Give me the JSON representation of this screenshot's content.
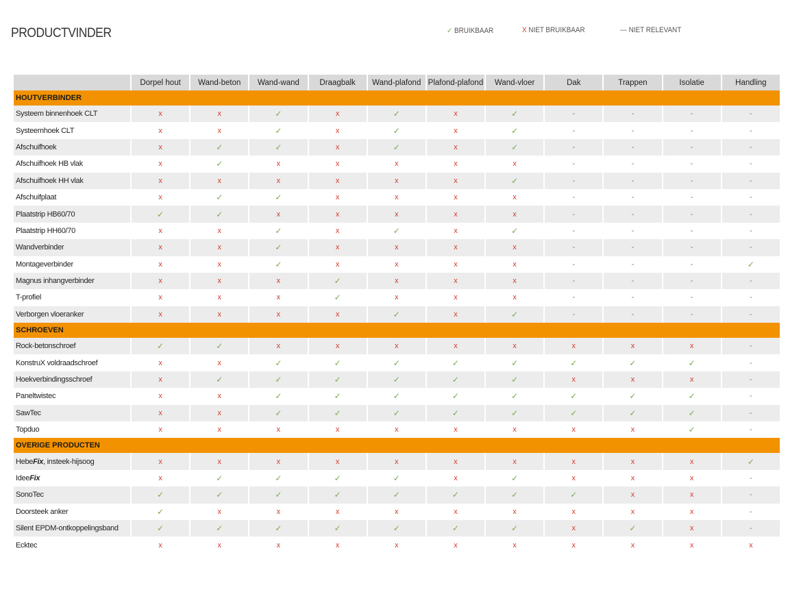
{
  "title": "PRODUCTVINDER",
  "legend": {
    "ok_symbol": "✓",
    "ok_label": "BRUIKBAAR",
    "no_symbol": "X",
    "no_label": "NIET BRUIKBAAR",
    "na_symbol": "—",
    "na_label": "NIET RELEVANT"
  },
  "symbols": {
    "ok": "✓",
    "no": "x",
    "na": "-"
  },
  "colors": {
    "header_gray": "#d9d9d9",
    "section_orange": "#f39200",
    "ok_green": "#7aa84a",
    "no_red": "#d23a2a"
  },
  "columns": [
    "Dorpel hout",
    "Wand-beton",
    "Wand-wand",
    "Draagbalk",
    "Wand-plafond",
    "Plafond-plafond",
    "Wand-vloer",
    "Dak",
    "Trappen",
    "Isolatie",
    "Handling"
  ],
  "sections": [
    {
      "name": "HOUTVERBINDER",
      "rows": [
        {
          "name": "Systeem binnenhoek CLT",
          "values": [
            "no",
            "no",
            "ok",
            "no",
            "ok",
            "no",
            "ok",
            "na",
            "na",
            "na",
            "na"
          ]
        },
        {
          "name": "Systeemhoek CLT",
          "values": [
            "no",
            "no",
            "ok",
            "no",
            "ok",
            "no",
            "ok",
            "na",
            "na",
            "na",
            "na"
          ]
        },
        {
          "name": "Afschuifhoek",
          "values": [
            "no",
            "ok",
            "ok",
            "no",
            "ok",
            "no",
            "ok",
            "na",
            "na",
            "na",
            "na"
          ]
        },
        {
          "name": "Afschuifhoek HB vlak",
          "values": [
            "no",
            "ok",
            "no",
            "no",
            "no",
            "no",
            "no",
            "na",
            "na",
            "na",
            "na"
          ]
        },
        {
          "name": "Afschuifhoek HH vlak",
          "values": [
            "no",
            "no",
            "no",
            "no",
            "no",
            "no",
            "ok",
            "na",
            "na",
            "na",
            "na"
          ]
        },
        {
          "name": "Afschuifplaat",
          "values": [
            "no",
            "ok",
            "ok",
            "no",
            "no",
            "no",
            "no",
            "na",
            "na",
            "na",
            "na"
          ]
        },
        {
          "name": "Plaatstrip HB60/70",
          "values": [
            "ok",
            "ok",
            "no",
            "no",
            "no",
            "no",
            "no",
            "na",
            "na",
            "na",
            "na"
          ]
        },
        {
          "name": "Plaatstrip HH60/70",
          "values": [
            "no",
            "no",
            "ok",
            "no",
            "ok",
            "no",
            "ok",
            "na",
            "na",
            "na",
            "na"
          ]
        },
        {
          "name": "Wandverbinder",
          "values": [
            "no",
            "no",
            "ok",
            "no",
            "no",
            "no",
            "no",
            "na",
            "na",
            "na",
            "na"
          ]
        },
        {
          "name": "Montageverbinder",
          "values": [
            "no",
            "no",
            "ok",
            "no",
            "no",
            "no",
            "no",
            "na",
            "na",
            "na",
            "ok"
          ]
        },
        {
          "name": "Magnus inhangverbinder",
          "values": [
            "no",
            "no",
            "no",
            "ok",
            "no",
            "no",
            "no",
            "na",
            "na",
            "na",
            "na"
          ]
        },
        {
          "name": "T-profiel",
          "values": [
            "no",
            "no",
            "no",
            "ok",
            "no",
            "no",
            "no",
            "na",
            "na",
            "na",
            "na"
          ]
        },
        {
          "name": "Verborgen vloeranker",
          "values": [
            "no",
            "no",
            "no",
            "no",
            "ok",
            "no",
            "ok",
            "na",
            "na",
            "na",
            "na"
          ]
        }
      ]
    },
    {
      "name": "SCHROEVEN",
      "rows": [
        {
          "name": "Rock-betonschroef",
          "values": [
            "ok",
            "ok",
            "no",
            "no",
            "no",
            "no",
            "no",
            "no",
            "no",
            "no",
            "na"
          ]
        },
        {
          "name": "KonstruX voldraadschroef",
          "values": [
            "no",
            "no",
            "ok",
            "ok",
            "ok",
            "ok",
            "ok",
            "ok",
            "ok",
            "ok",
            "na"
          ]
        },
        {
          "name": "Hoekverbindingsschroef",
          "values": [
            "no",
            "ok",
            "ok",
            "ok",
            "ok",
            "ok",
            "ok",
            "no",
            "no",
            "no",
            "na"
          ]
        },
        {
          "name": "Paneltwistec",
          "values": [
            "no",
            "no",
            "ok",
            "ok",
            "ok",
            "ok",
            "ok",
            "ok",
            "ok",
            "ok",
            "na"
          ]
        },
        {
          "name": "SawTec",
          "values": [
            "no",
            "no",
            "ok",
            "ok",
            "ok",
            "ok",
            "ok",
            "ok",
            "ok",
            "ok",
            "na"
          ]
        },
        {
          "name": "Topduo",
          "values": [
            "no",
            "no",
            "no",
            "no",
            "no",
            "no",
            "no",
            "no",
            "no",
            "ok",
            "na"
          ]
        }
      ]
    },
    {
      "name": "OVERIGE PRODUCTEN",
      "rows": [
        {
          "name": "HebeFix, insteek-hijsoog",
          "name_plain": "Hebe",
          "name_bold": "Fix",
          "name_rest": ", insteek-hijsoog",
          "values": [
            "no",
            "no",
            "no",
            "no",
            "no",
            "no",
            "no",
            "no",
            "no",
            "no",
            "ok"
          ]
        },
        {
          "name": "IdeeFix",
          "name_plain": "Idee",
          "name_bold": "Fix",
          "name_rest": "",
          "values": [
            "no",
            "ok",
            "ok",
            "ok",
            "ok",
            "no",
            "ok",
            "no",
            "no",
            "no",
            "na"
          ]
        },
        {
          "name": "SonoTec",
          "values": [
            "ok",
            "ok",
            "ok",
            "ok",
            "ok",
            "ok",
            "ok",
            "ok",
            "no",
            "no",
            "na"
          ]
        },
        {
          "name": "Doorsteek anker",
          "values": [
            "ok",
            "no",
            "no",
            "no",
            "no",
            "no",
            "no",
            "no",
            "no",
            "no",
            "na"
          ]
        },
        {
          "name": "Silent EPDM-ontkoppelingsband",
          "values": [
            "ok",
            "ok",
            "ok",
            "ok",
            "ok",
            "ok",
            "ok",
            "no",
            "ok",
            "no",
            "na"
          ]
        },
        {
          "name": "Ecktec",
          "values": [
            "no",
            "no",
            "no",
            "no",
            "no",
            "no",
            "no",
            "no",
            "no",
            "no",
            "no"
          ]
        }
      ]
    }
  ]
}
